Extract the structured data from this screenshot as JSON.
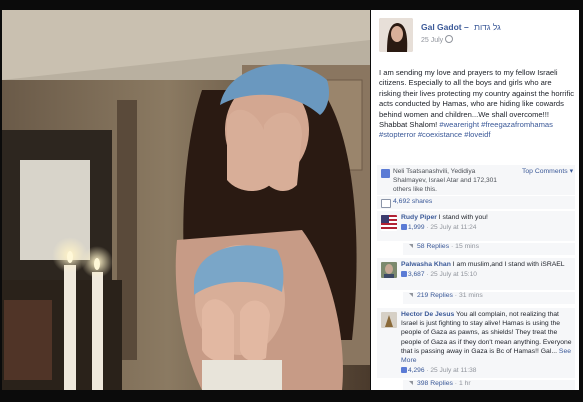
{
  "post": {
    "author": "Gal Gadot",
    "author_hebrew": "גל גדות",
    "date": "25 July",
    "text": "I am sending my love and prayers to my fellow Israeli citizens. Especially to all the boys and girls who are risking their lives protecting my country against the horrific acts conducted by Hamas, who are hiding like cowards behind women and children...We shall overcome!!! Shabbat Shalom!",
    "hashtags": "#weareright #freegazafromhamas #stopterror #coexistance #loveidf"
  },
  "likes": {
    "text": "Neli Tsatsanashvili, Yedidiya Shalmayev, Israel Atar and 172,301 others like this.",
    "sort_label": "Top Comments ▾"
  },
  "shares": {
    "text": "4,692 shares"
  },
  "comments": [
    {
      "author": "Rudy Piper",
      "text": "I stand with you!",
      "likes": "1,999",
      "date": "25 July at 11:24",
      "replies": "58 Replies",
      "replies_time": "15 mins"
    },
    {
      "author": "Palwasha Khan",
      "text": "I am muslim,and I stand with iSRAEL",
      "likes": "3,687",
      "date": "25 July at 15:10",
      "replies": "219 Replies",
      "replies_time": "31 mins"
    },
    {
      "author": "Hector De Jesus",
      "text": "You all complain, not realizing that Israel is just fighting to stay alive! Hamas is using the people of Gaza as pawns, as shields! They treat the people of Gaza as if they don't mean anything. Everyone that is passing away in Gaza is Bc of Hamas!! Gal...",
      "see_more": "See More",
      "likes": "4,296",
      "date": "25 July at 11:38",
      "replies": "398 Replies",
      "replies_time": "1 hr"
    }
  ],
  "colors": {
    "link": "#3b5998",
    "meta": "#90949c",
    "panel_bg": "#ffffff",
    "comment_bg": "#f6f7f9"
  }
}
